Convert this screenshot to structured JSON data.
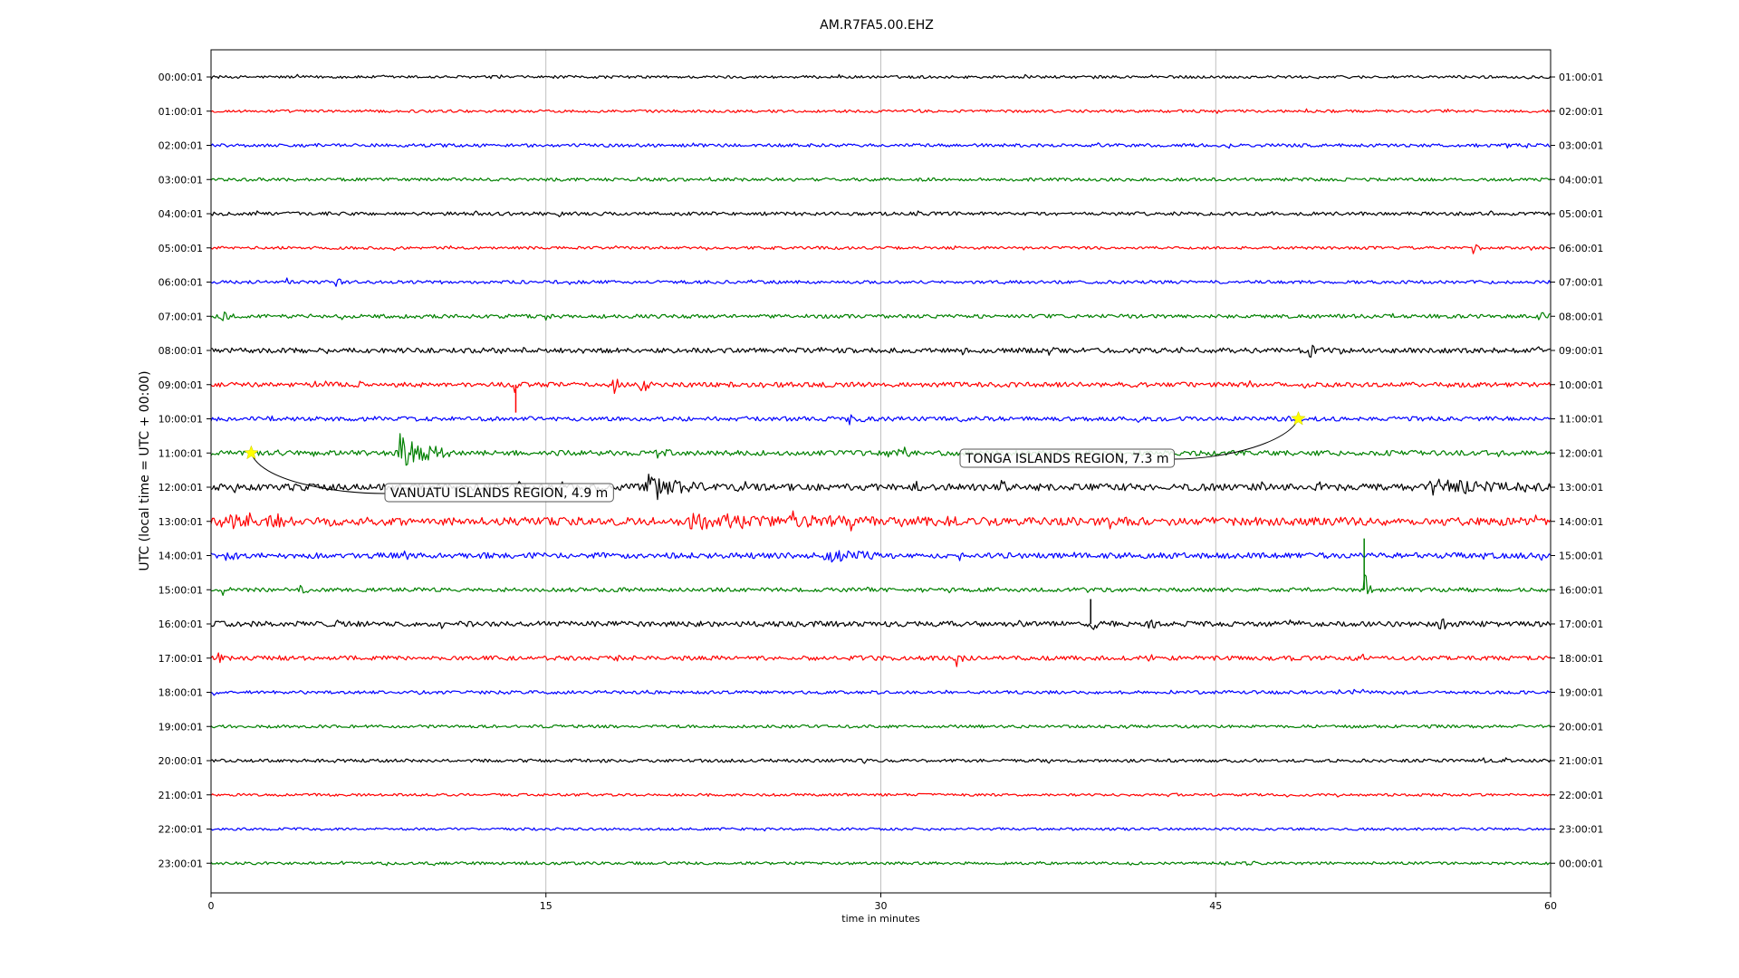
{
  "chart_data": {
    "type": "line",
    "title": "AM.R7FA5.00.EHZ",
    "xlabel": "time in minutes",
    "ylabel": "UTC (local time = UTC + 00:00)",
    "xlim": [
      0,
      60
    ],
    "x_ticks": [
      0,
      15,
      30,
      45,
      60
    ],
    "x_tick_labels": [
      "0",
      "15",
      "30",
      "45",
      "60"
    ],
    "vertical_grid": true,
    "color_cycle": [
      "#000000",
      "#ff0000",
      "#0000ff",
      "#008000"
    ],
    "left_labels": [
      "00:00:01",
      "01:00:01",
      "02:00:01",
      "03:00:01",
      "04:00:01",
      "05:00:01",
      "06:00:01",
      "07:00:01",
      "08:00:01",
      "09:00:01",
      "10:00:01",
      "11:00:01",
      "12:00:01",
      "13:00:01",
      "14:00:01",
      "15:00:01",
      "16:00:01",
      "17:00:01",
      "18:00:01",
      "19:00:01",
      "20:00:01",
      "21:00:01",
      "22:00:01",
      "23:00:01"
    ],
    "right_labels": [
      "01:00:01",
      "02:00:01",
      "03:00:01",
      "04:00:01",
      "05:00:01",
      "06:00:01",
      "07:00:01",
      "08:00:01",
      "09:00:01",
      "10:00:01",
      "11:00:01",
      "12:00:01",
      "13:00:01",
      "14:00:01",
      "15:00:01",
      "16:00:01",
      "17:00:01",
      "18:00:01",
      "19:00:01",
      "20:00:01",
      "21:00:01",
      "22:00:01",
      "23:00:01",
      "00:00:01"
    ],
    "noise_level": [
      0.22,
      0.22,
      0.26,
      0.25,
      0.28,
      0.22,
      0.25,
      0.3,
      0.4,
      0.38,
      0.35,
      0.4,
      0.55,
      0.65,
      0.45,
      0.32,
      0.42,
      0.35,
      0.26,
      0.24,
      0.25,
      0.2,
      0.2,
      0.22
    ],
    "bursts": [
      {
        "row": 5,
        "t": 56.5,
        "amp": 0.9,
        "dur": 0.4
      },
      {
        "row": 6,
        "t": 3.4,
        "amp": 0.7,
        "dur": 0.6
      },
      {
        "row": 6,
        "t": 5.6,
        "amp": 0.6,
        "dur": 0.4
      },
      {
        "row": 7,
        "t": 0.5,
        "amp": 0.7,
        "dur": 0.5
      },
      {
        "row": 7,
        "t": 15.0,
        "amp": 0.6,
        "dur": 0.5
      },
      {
        "row": 7,
        "t": 59.5,
        "amp": 0.7,
        "dur": 0.5
      },
      {
        "row": 8,
        "t": 14.0,
        "amp": 0.7,
        "dur": 0.2
      },
      {
        "row": 8,
        "t": 37.5,
        "amp": 0.7,
        "dur": 0.4
      },
      {
        "row": 8,
        "t": 49.2,
        "amp": 1.6,
        "dur": 0.3
      },
      {
        "row": 9,
        "t": 13.6,
        "amp": 1.8,
        "dur": 0.3
      },
      {
        "row": 9,
        "t": 18.0,
        "amp": 1.0,
        "dur": 0.6
      },
      {
        "row": 9,
        "t": 19.2,
        "amp": 1.4,
        "dur": 0.7
      },
      {
        "row": 10,
        "t": 28.5,
        "amp": 0.8,
        "dur": 1.2
      },
      {
        "row": 11,
        "t": 8.5,
        "amp": 3.2,
        "dur": 2.2
      },
      {
        "row": 11,
        "t": 19.8,
        "amp": 0.9,
        "dur": 0.8
      },
      {
        "row": 11,
        "t": 31.0,
        "amp": 0.8,
        "dur": 0.4
      },
      {
        "row": 12,
        "t": 19.5,
        "amp": 1.7,
        "dur": 2.5
      },
      {
        "row": 12,
        "t": 54.5,
        "amp": 1.0,
        "dur": 5.4
      },
      {
        "row": 12,
        "t": 35.4,
        "amp": 0.7,
        "dur": 0.5
      },
      {
        "row": 13,
        "t": 0.5,
        "amp": 0.8,
        "dur": 5.0
      },
      {
        "row": 13,
        "t": 21.5,
        "amp": 0.8,
        "dur": 12.0
      },
      {
        "row": 14,
        "t": 0.6,
        "amp": 0.8,
        "dur": 0.6
      },
      {
        "row": 14,
        "t": 27.5,
        "amp": 0.8,
        "dur": 2.8
      },
      {
        "row": 14,
        "t": 56.5,
        "amp": 0.5,
        "dur": 1.0
      },
      {
        "row": 15,
        "t": 0.5,
        "amp": 0.8,
        "dur": 0.5
      },
      {
        "row": 15,
        "t": 4.0,
        "amp": 0.6,
        "dur": 0.5
      },
      {
        "row": 15,
        "t": 51.7,
        "amp": 1.3,
        "dur": 0.3
      },
      {
        "row": 15,
        "t": 51.7,
        "amp": 1.3,
        "dur": 0.3
      },
      {
        "row": 16,
        "t": 39.4,
        "amp": 1.1,
        "dur": 0.4
      },
      {
        "row": 16,
        "t": 42.0,
        "amp": 1.0,
        "dur": 0.4
      },
      {
        "row": 16,
        "t": 48.3,
        "amp": 0.8,
        "dur": 0.6
      },
      {
        "row": 16,
        "t": 55.0,
        "amp": 0.8,
        "dur": 0.6
      },
      {
        "row": 17,
        "t": 0.2,
        "amp": 1.2,
        "dur": 0.5
      },
      {
        "row": 17,
        "t": 33.4,
        "amp": 1.0,
        "dur": 0.4
      },
      {
        "row": 21,
        "t": 42.8,
        "amp": 0.6,
        "dur": 0.6
      }
    ],
    "spikes": [
      {
        "row": 15,
        "t": 51.65,
        "amp": 3.3,
        "dir": 1
      },
      {
        "row": 16,
        "t": 39.4,
        "amp": 1.6,
        "dir": 1
      },
      {
        "row": 9,
        "t": 13.65,
        "amp": 1.8,
        "dir": -1
      }
    ],
    "events": [
      {
        "label": "VANUATU ISLANDS REGION, 4.9 m",
        "time_utc": "11:01:48",
        "row": 11,
        "t": 1.8
      },
      {
        "label": "TONGA ISLANDS REGION, 7.3 m",
        "time_utc": "10:48:42",
        "row": 10,
        "t": 48.7
      }
    ]
  }
}
